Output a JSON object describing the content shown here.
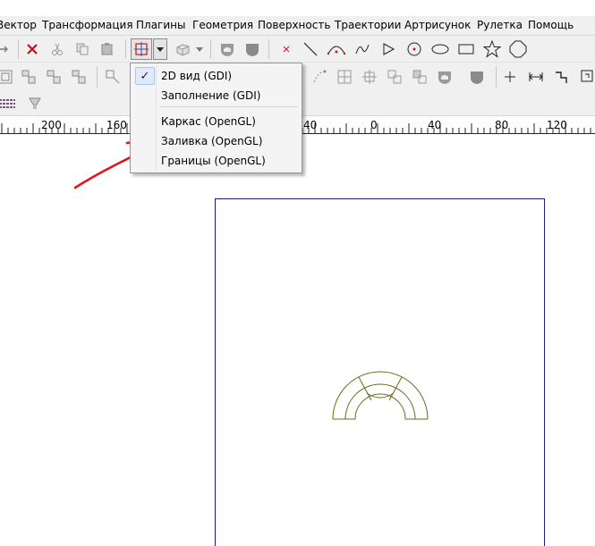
{
  "menu": {
    "items": [
      "Вектор",
      "Трансформация",
      "Плагины",
      "Геометрия",
      "Поверхность",
      "Траектории",
      "Артрисунок",
      "Рулетка",
      "Помощь"
    ]
  },
  "dropdown": {
    "items": [
      {
        "label": "2D вид (GDI)",
        "checked": true
      },
      {
        "label": "Заполнение (GDI)",
        "checked": false
      },
      {
        "label": "Каркас (OpenGL)",
        "checked": false
      },
      {
        "label": "Заливка (OpenGL)",
        "checked": false
      },
      {
        "label": "Границы (OpenGL)",
        "checked": false
      }
    ],
    "check_glyph": "✓"
  },
  "ruler": {
    "labels": [
      "200",
      "160",
      "40",
      "0",
      "40",
      "80",
      "120"
    ]
  },
  "colors": {
    "annotation_arrow": "#e0141e",
    "page_border": "#1a1a8c",
    "drawing_stroke": "#6b6b1e",
    "delete_icon": "#c0141a",
    "active_view_icon": "#d4141a"
  },
  "icons": {
    "toolbar1": [
      "delete-icon",
      "cut-icon",
      "copy-icon",
      "paste-icon",
      "view-mode-icon",
      "dropdown-arrow-icon",
      "3d-box-icon",
      "shield-icon",
      "shield-filled-icon",
      "point-icon",
      "line-icon",
      "arc-icon",
      "curve-icon",
      "triangle-icon",
      "circle-point-icon",
      "ellipse-icon",
      "rectangle-icon",
      "star-icon",
      "octagon-icon"
    ],
    "toolbar2": [
      "group-icon",
      "ungroup-icon",
      "node-icon",
      "node-edit-icon",
      "crosshair-icon",
      "dimension-icon",
      "step-icon",
      "step-square-icon"
    ],
    "toolbar3": [
      "hatch-icon",
      "lamp-icon"
    ]
  }
}
